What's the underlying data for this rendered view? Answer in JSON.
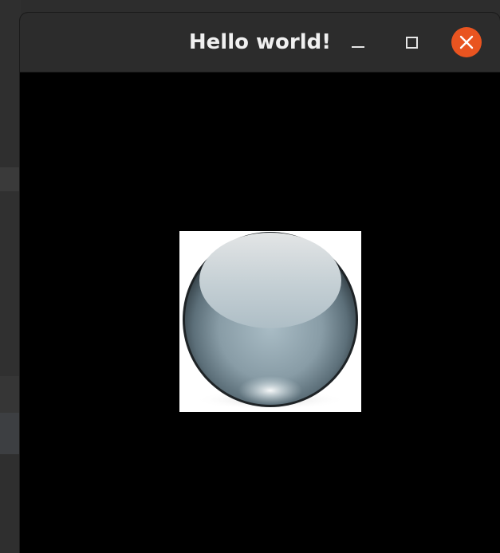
{
  "window": {
    "title": "Hello world!",
    "controls": {
      "minimize": "minimize-icon",
      "maximize": "maximize-icon",
      "close": "close-icon"
    },
    "close_color": "#e95420",
    "titlebar_color": "#2c2c2c"
  },
  "content": {
    "background": "#000000",
    "image": "glass-sphere"
  }
}
